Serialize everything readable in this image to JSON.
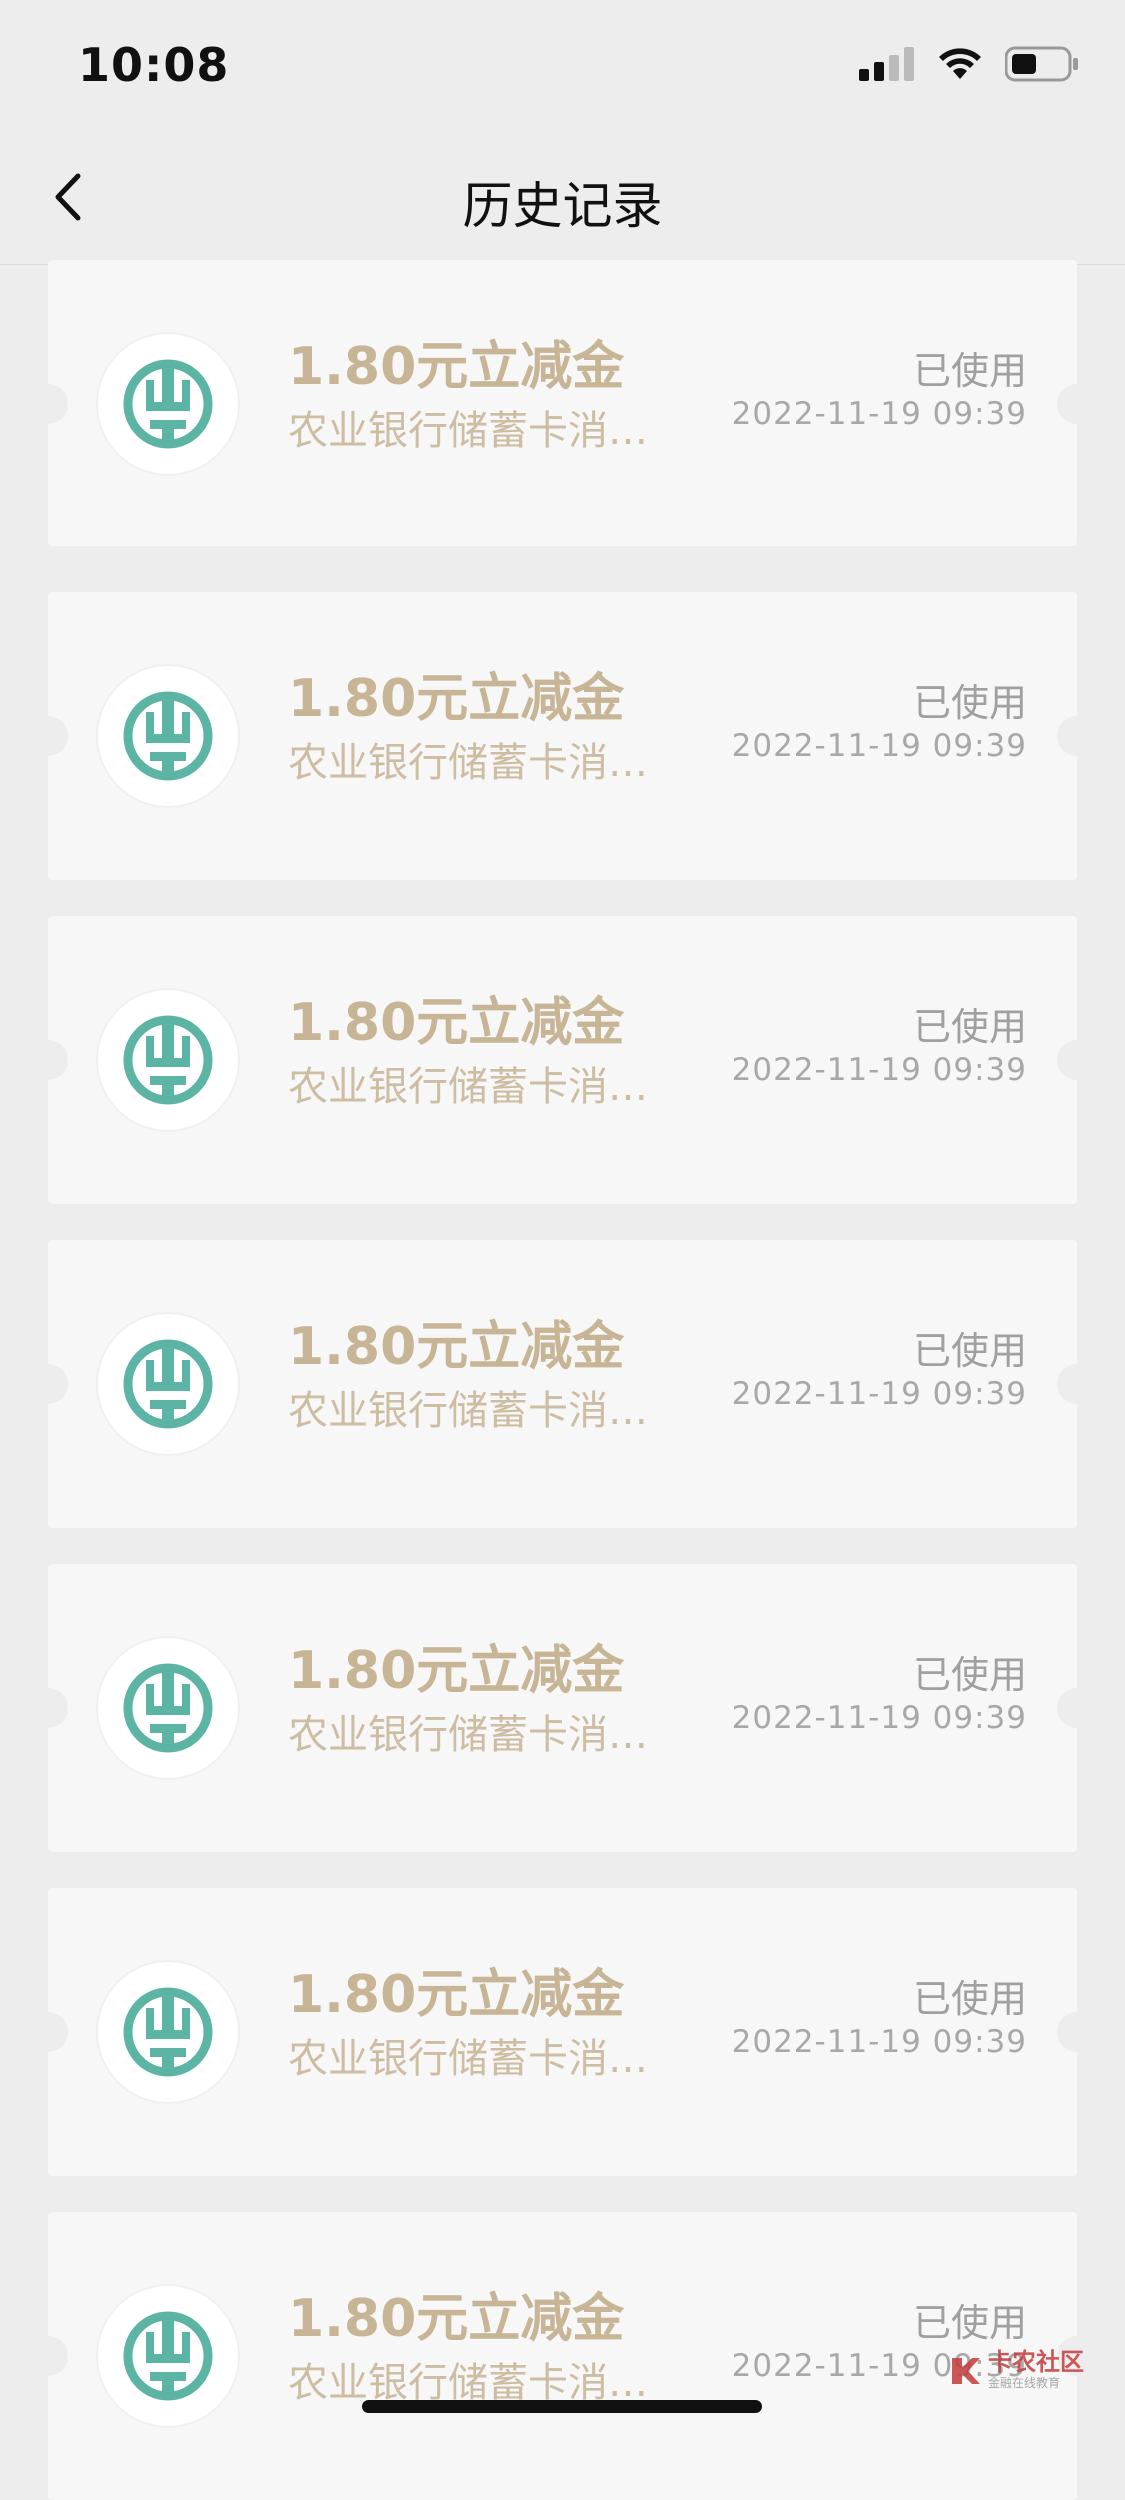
{
  "status_bar": {
    "time": "10:08"
  },
  "navbar": {
    "title": "历史记录"
  },
  "records": [
    {
      "amount": "1.80元立减金",
      "desc": "农业银行储蓄卡消…",
      "status": "已使用",
      "datetime": "2022-11-19 09:39"
    },
    {
      "amount": "1.80元立减金",
      "desc": "农业银行储蓄卡消…",
      "status": "已使用",
      "datetime": "2022-11-19 09:39"
    },
    {
      "amount": "1.80元立减金",
      "desc": "农业银行储蓄卡消…",
      "status": "已使用",
      "datetime": "2022-11-19 09:39"
    },
    {
      "amount": "1.80元立减金",
      "desc": "农业银行储蓄卡消…",
      "status": "已使用",
      "datetime": "2022-11-19 09:39"
    },
    {
      "amount": "1.80元立减金",
      "desc": "农业银行储蓄卡消…",
      "status": "已使用",
      "datetime": "2022-11-19 09:39"
    },
    {
      "amount": "1.80元立减金",
      "desc": "农业银行储蓄卡消…",
      "status": "已使用",
      "datetime": "2022-11-19 09:39"
    },
    {
      "amount": "1.80元立减金",
      "desc": "农业银行储蓄卡消…",
      "status": "已使用",
      "datetime": "2022-11-19 09:39"
    }
  ],
  "watermark": {
    "text": "卡农社区",
    "sub": "金融在线教育"
  },
  "colors": {
    "logo": "#5cb4a4",
    "amount": "#c7b596"
  },
  "icons": [
    "back-arrow-icon",
    "signal-icon",
    "wifi-icon",
    "battery-icon",
    "abc-bank-logo-icon"
  ]
}
